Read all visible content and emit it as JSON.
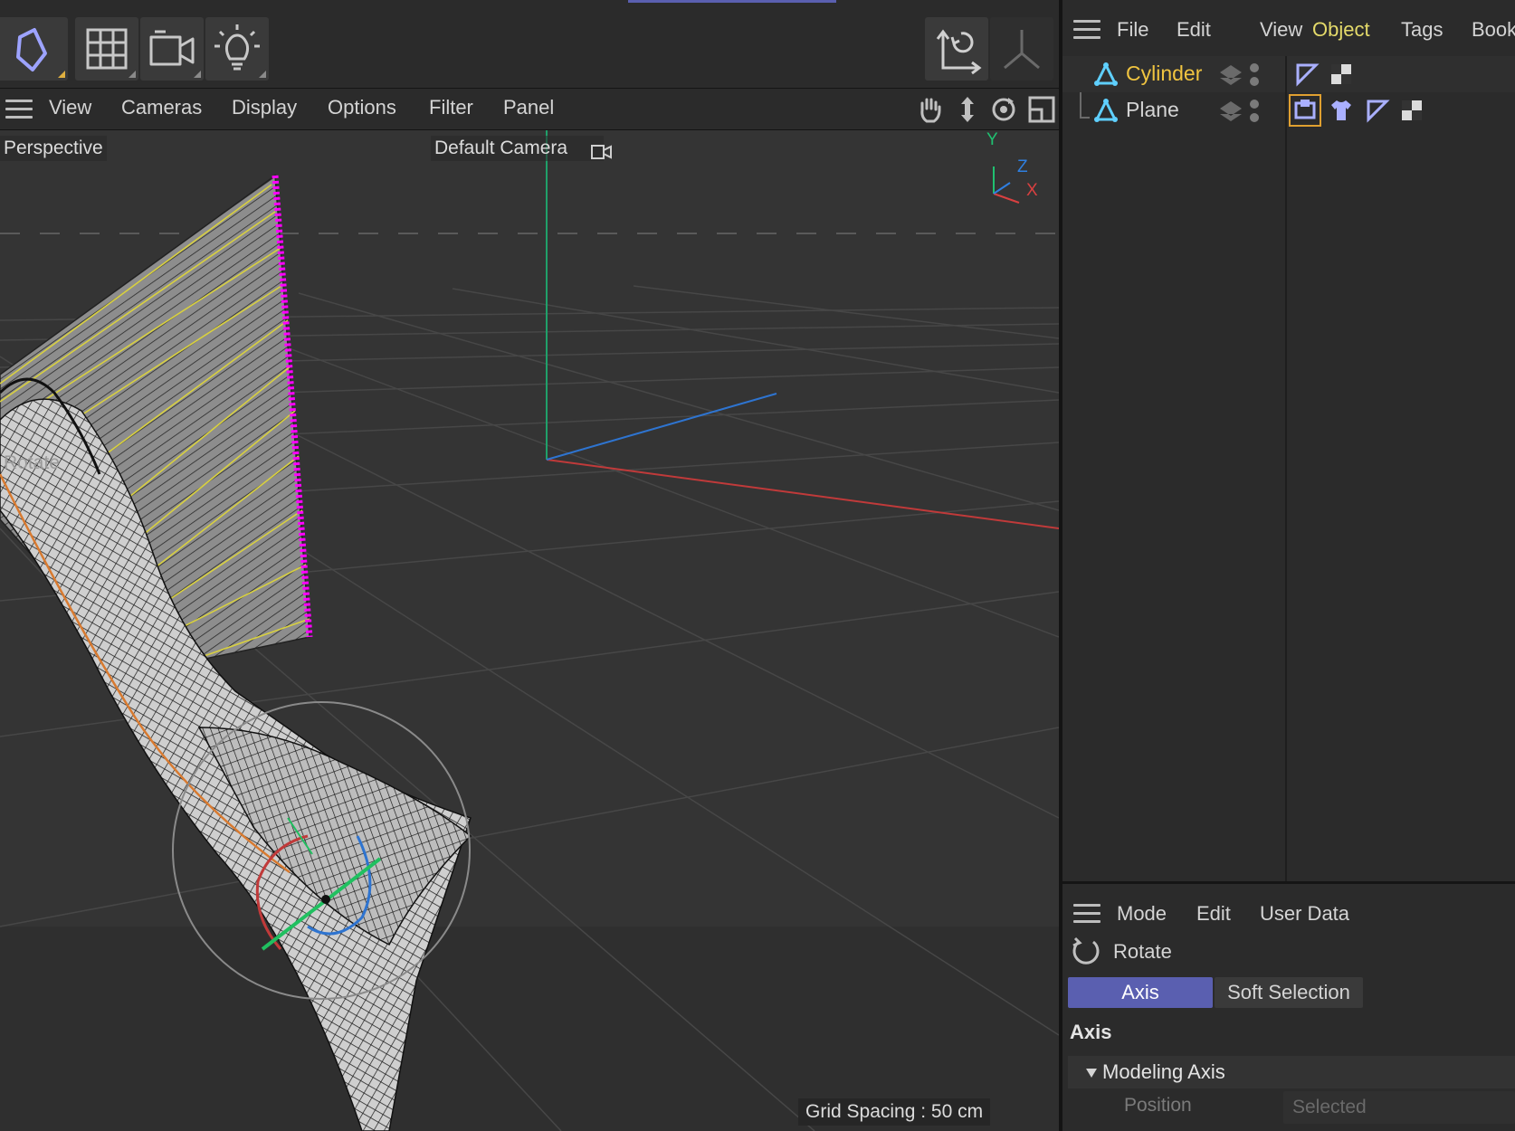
{
  "viewport_menu": [
    "View",
    "Cameras",
    "Display",
    "Options",
    "Filter",
    "Panel"
  ],
  "viewport": {
    "projection_label": "Perspective",
    "camera_label": "Default Camera",
    "tool_hint": "Rotate",
    "grid_spacing": "Grid Spacing : 50 cm",
    "axis_labels": {
      "y": "Y",
      "z": "Z",
      "x": "X"
    }
  },
  "object_manager": {
    "menu": [
      "File",
      "Edit",
      "View",
      "Object",
      "Tags",
      "Book"
    ],
    "objects": [
      {
        "name": "Cylinder",
        "selected": true
      },
      {
        "name": "Plane",
        "selected": false
      }
    ]
  },
  "attribute_manager": {
    "menu": [
      "Mode",
      "Edit",
      "User Data"
    ],
    "tool_name": "Rotate",
    "tabs": [
      "Axis",
      "Soft Selection"
    ],
    "active_tab": "Axis",
    "section_title": "Axis",
    "group_title": "Modeling Axis",
    "field_label": "Position",
    "field_value": "Selected"
  },
  "colors": {
    "accent": "#5a5fb0",
    "selected_object": "#f0c440",
    "point_selection": "#ff00ff",
    "axis_x": "#d94040",
    "axis_y": "#20c070",
    "axis_z": "#2f7fe0"
  }
}
